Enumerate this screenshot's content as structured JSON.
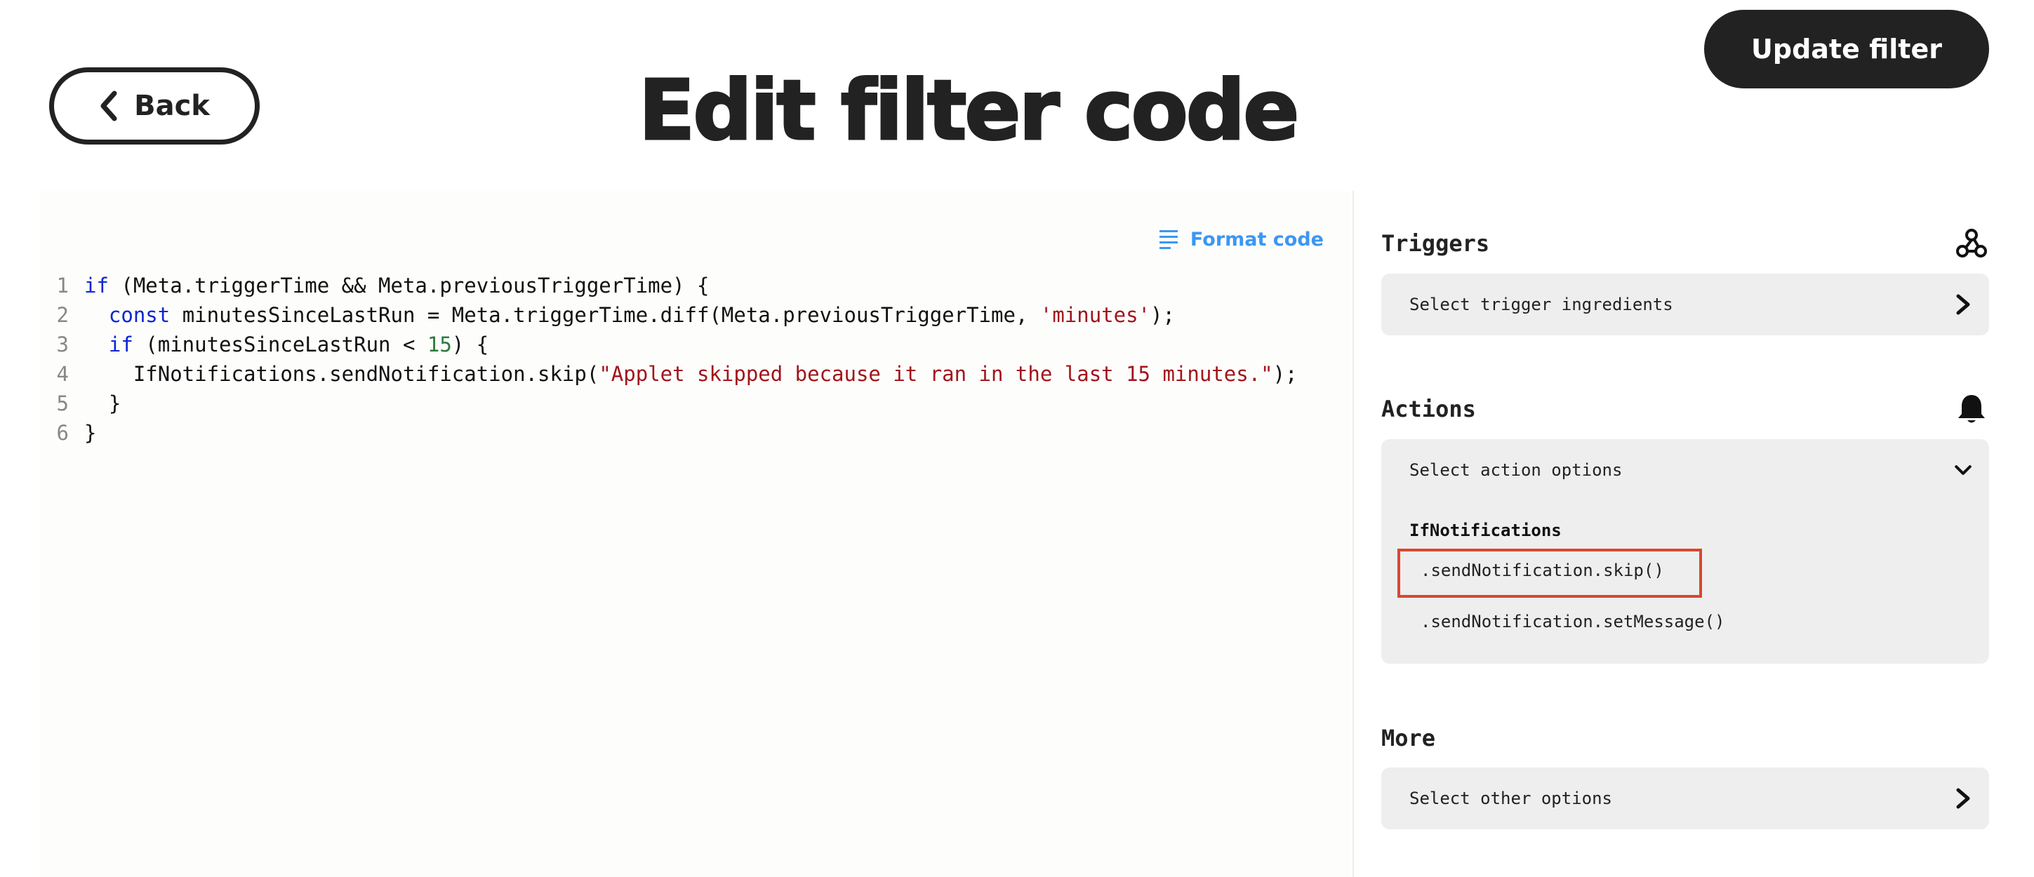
{
  "header": {
    "back_label": "Back",
    "title": "Edit filter code",
    "update_label": "Update filter"
  },
  "editor": {
    "format_label": "Format code",
    "lines": [
      {
        "n": "1",
        "tokens": [
          [
            "kw",
            "if"
          ],
          [
            "pl",
            " (Meta.triggerTime && Meta.previousTriggerTime) {"
          ]
        ]
      },
      {
        "n": "2",
        "tokens": [
          [
            "pl",
            "  "
          ],
          [
            "kw",
            "const"
          ],
          [
            "pl",
            " minutesSinceLastRun = Meta.triggerTime.diff(Meta.previousTriggerTime, "
          ],
          [
            "str",
            "'minutes'"
          ],
          [
            "pl",
            ");"
          ]
        ]
      },
      {
        "n": "3",
        "tokens": [
          [
            "pl",
            "  "
          ],
          [
            "kw",
            "if"
          ],
          [
            "pl",
            " (minutesSinceLastRun < "
          ],
          [
            "num",
            "15"
          ],
          [
            "pl",
            ") {"
          ]
        ]
      },
      {
        "n": "4",
        "tokens": [
          [
            "pl",
            "    IfNotifications.sendNotification.skip("
          ],
          [
            "str",
            "\"Applet skipped because it ran in the last 15 minutes.\""
          ],
          [
            "pl",
            ");"
          ]
        ]
      },
      {
        "n": "5",
        "tokens": [
          [
            "pl",
            "  }"
          ]
        ]
      },
      {
        "n": "6",
        "tokens": [
          [
            "pl",
            "}"
          ]
        ]
      }
    ],
    "colors": {
      "keyword": "#0a26d1",
      "string": "#a1151b",
      "number": "#2c7a3d",
      "format_link": "#3b97f3"
    }
  },
  "sidebar": {
    "triggers": {
      "title": "Triggers",
      "select_label": "Select trigger ingredients",
      "icon": "webhook-icon"
    },
    "actions": {
      "title": "Actions",
      "select_label": "Select action options",
      "icon": "bell-icon",
      "group": "IfNotifications",
      "options": [
        ".sendNotification.skip()",
        ".sendNotification.setMessage()"
      ],
      "highlight_color": "#d9472f"
    },
    "more": {
      "title": "More",
      "select_label": "Select other options"
    }
  }
}
